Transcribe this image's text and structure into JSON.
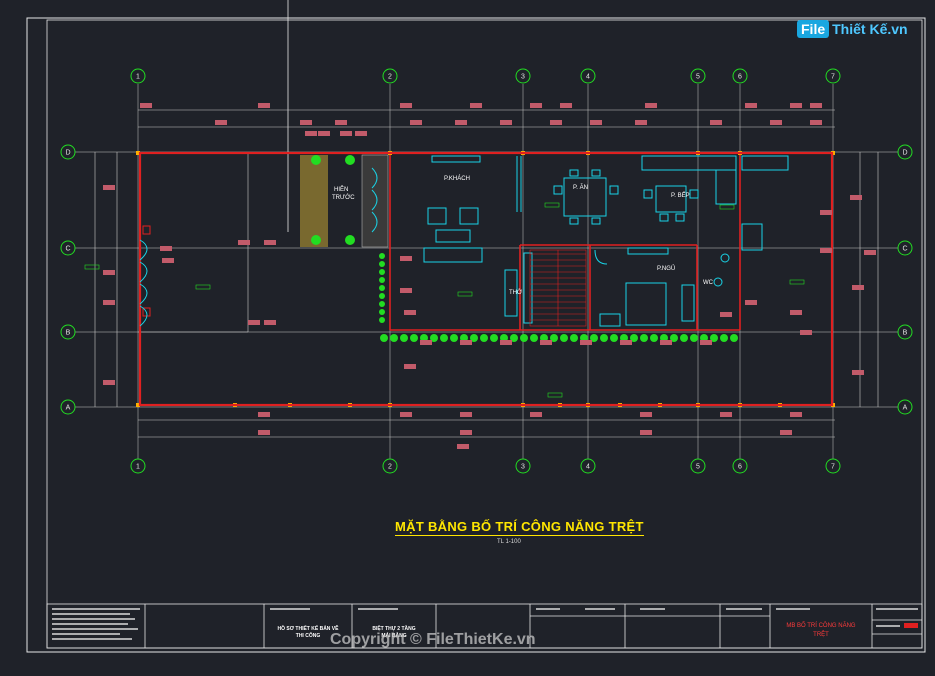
{
  "drawing": {
    "title": "MẶT BẰNG BỐ TRÍ CÔNG NĂNG TRỆT",
    "scale": "TL 1-100",
    "colors": {
      "background": "#1f2229",
      "frame": "#e6e6e6",
      "wall": "#e02020",
      "furniture": "#19d3e6",
      "title": "#ffe600",
      "dim": "#c9c9c9",
      "plant": "#22dd22",
      "axis_bubble": "#22dd22"
    }
  },
  "grid_axes": {
    "columns": [
      "1",
      "2",
      "3",
      "4",
      "5",
      "6",
      "7"
    ],
    "rows": [
      "D",
      "C",
      "B",
      "A"
    ]
  },
  "rooms": {
    "living": "P.KHÁCH",
    "dining": "P. ĂN",
    "kitchen": "P. BẾP",
    "bedroom": "P.NGỦ",
    "porch_line1": "HIÊN",
    "porch_line2": "TRƯỚC",
    "worship": "THỜ",
    "wc": "WC"
  },
  "title_block": {
    "project_line1": "HỒ SƠ THIẾT KẾ BẢN VẼ",
    "project_line2": "THI CÔNG",
    "building_line1": "BIỆT THỰ 2 TẦNG",
    "building_line2": "MÁI BẰNG",
    "sheet_line1": "MB BỐ TRÍ CÔNG NĂNG",
    "sheet_line2": "TRỆT"
  },
  "watermark": {
    "logo_left": "File",
    "logo_right": "Thiết Kế.vn",
    "copyright": "Copyright © FileThietKe.vn"
  }
}
